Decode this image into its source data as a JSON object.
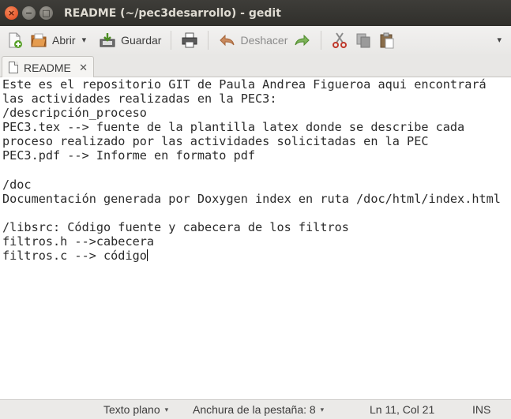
{
  "window": {
    "title": "README (~/pec3desarrollo) - gedit",
    "close_glyph": "×",
    "minimize_glyph": "−",
    "maximize_glyph": "□"
  },
  "toolbar": {
    "open_label": "Abrir",
    "save_label": "Guardar",
    "undo_label": "Deshacer",
    "dropdown_glyph": "▾",
    "overflow_glyph": "▾"
  },
  "tabs": [
    {
      "label": "README",
      "close_glyph": "✕"
    }
  ],
  "editor": {
    "lines": [
      "Este es el repositorio GIT de Paula Andrea Figueroa aqui encontrará",
      "las actividades realizadas en la PEC3:",
      "/descripción_proceso",
      "PEC3.tex --> fuente de la plantilla latex donde se describe cada",
      "proceso realizado por las actividades solicitadas en la PEC",
      "PEC3.pdf --> Informe en formato pdf",
      "",
      "/doc",
      "Documentación generada por Doxygen index en ruta /doc/html/index.html",
      "",
      "/libsrc: Código fuente y cabecera de los filtros",
      "filtros.h -->cabecera",
      "filtros.c --> código"
    ]
  },
  "statusbar": {
    "language": "Texto plano",
    "tab_width": "Anchura de la pestaña: 8",
    "position": "Ln 11, Col 21",
    "mode": "INS",
    "dropdown_glyph": "▾"
  }
}
